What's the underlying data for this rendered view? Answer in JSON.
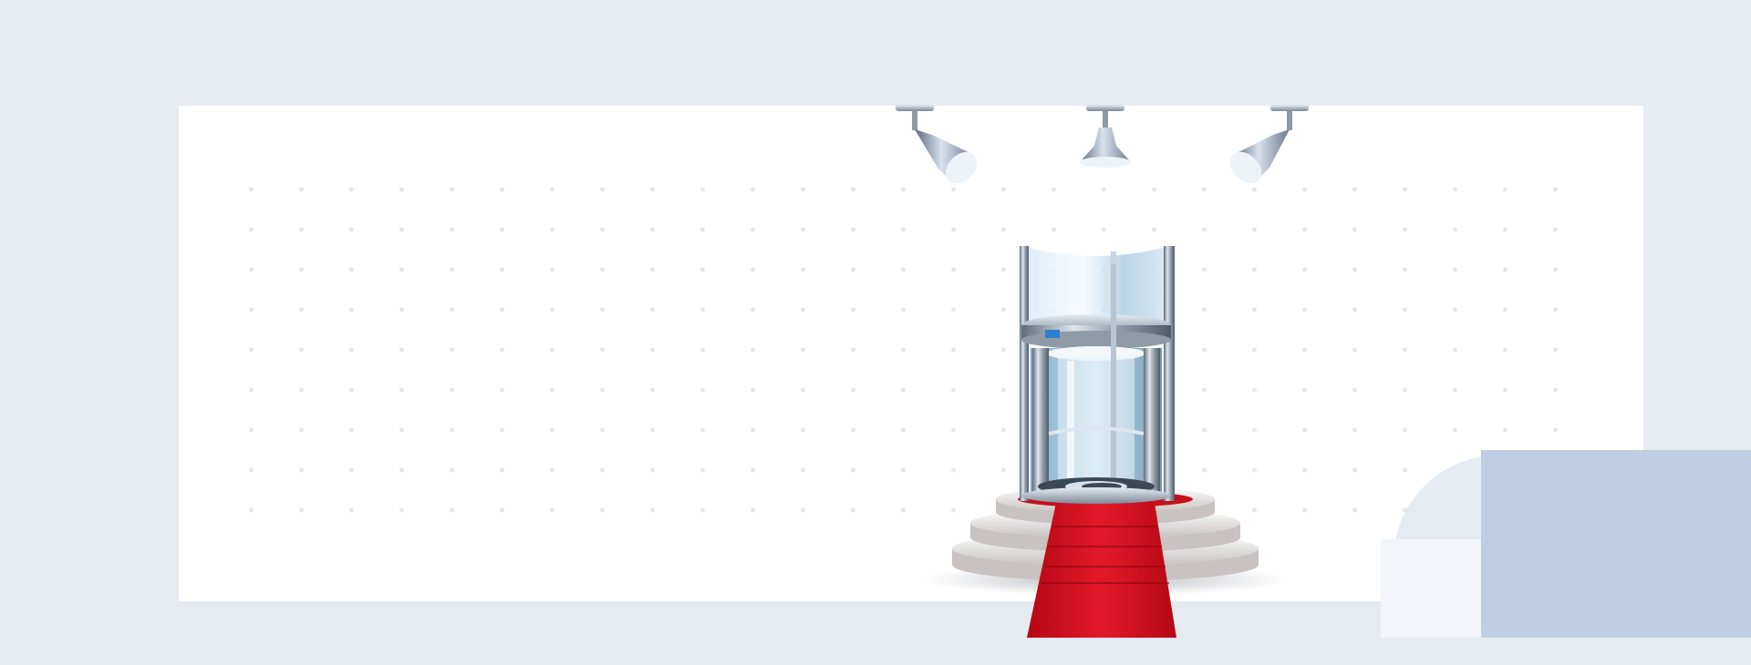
{
  "colors": {
    "page_background": "#e6ebf2",
    "panel": "#ffffff",
    "dot": "#e3e6ec",
    "carpet": "#d3101c",
    "accent_blue_block": "#bfcfe3",
    "pale_block": "#f2f6fb",
    "glass": "#b9d7ec",
    "steel": "#8e99a6"
  },
  "illustration": {
    "subject": "glass-elevator-on-podium-icon",
    "spotlights": [
      "spotlight-icon",
      "spotlight-icon",
      "spotlight-icon"
    ],
    "podium_steps": 3,
    "carpet": "red-carpet-icon",
    "indicator_display": "floor-indicator-icon"
  }
}
